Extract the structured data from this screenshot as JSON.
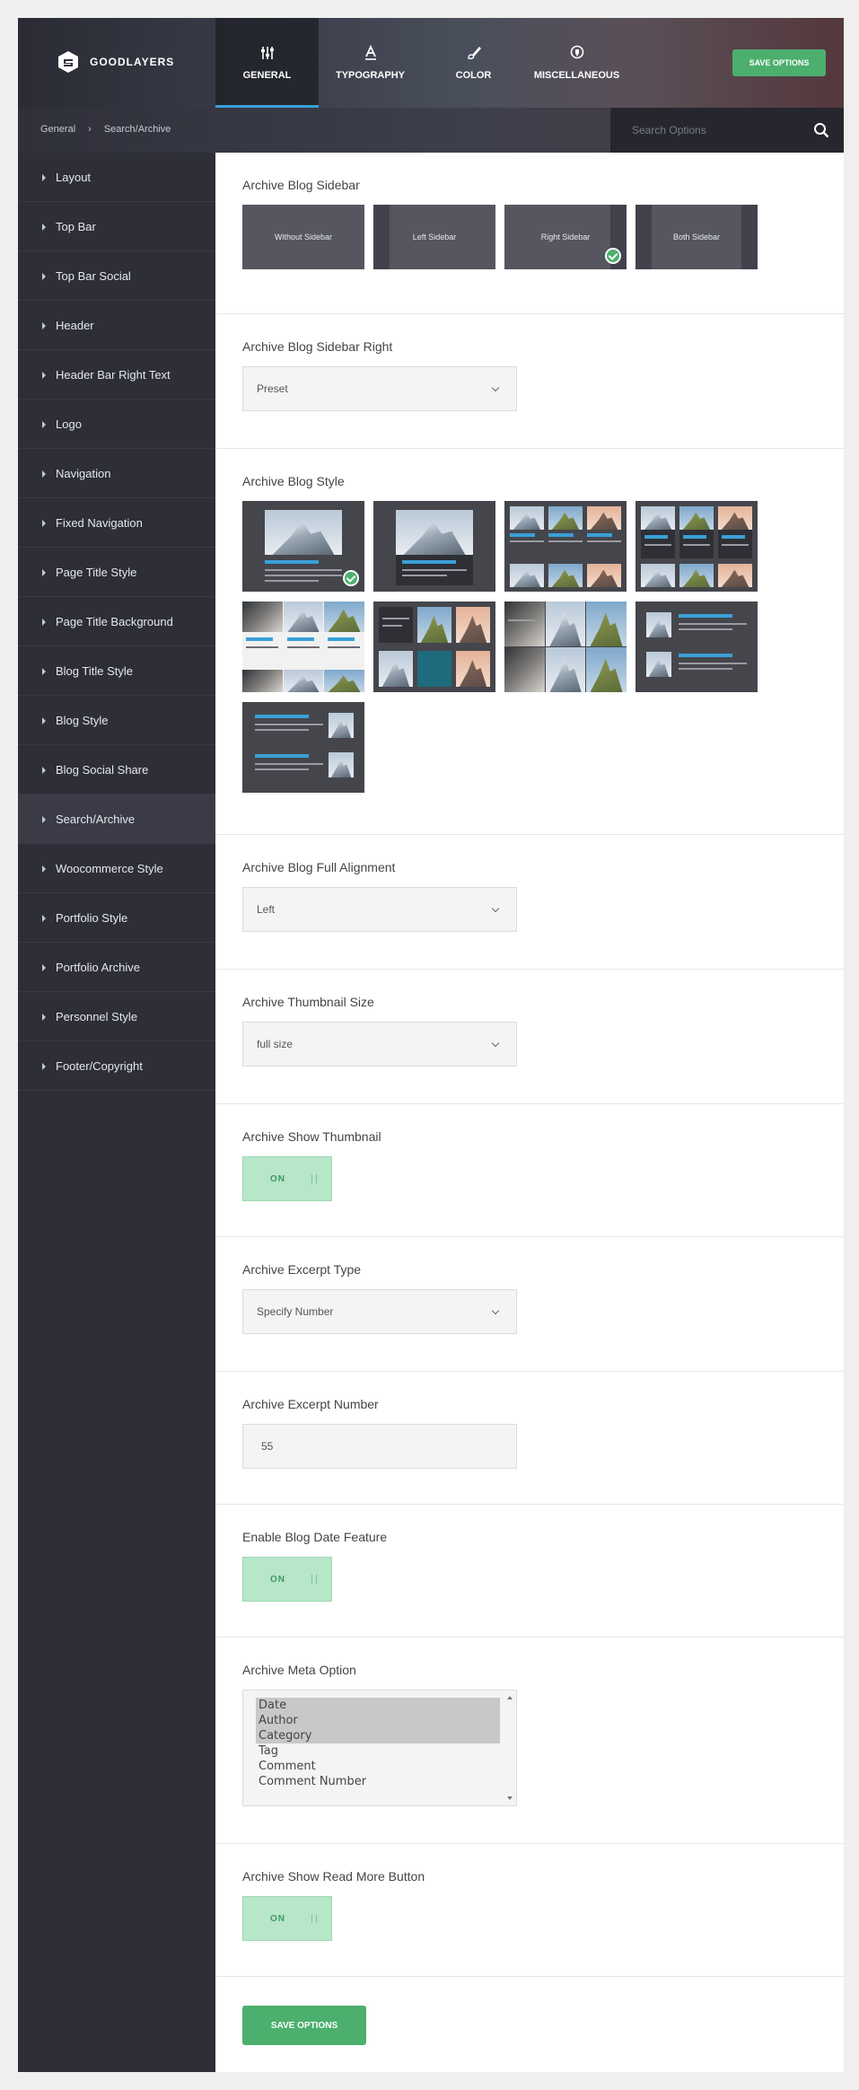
{
  "brand": {
    "name": "GOODLAYERS"
  },
  "main_tabs": [
    {
      "label": "GENERAL",
      "icon": "sliders-icon",
      "active": true
    },
    {
      "label": "TYPOGRAPHY",
      "icon": "typography-icon",
      "active": false
    },
    {
      "label": "COLOR",
      "icon": "brush-icon",
      "active": false
    },
    {
      "label": "MISCELLANEOUS",
      "icon": "shield-icon",
      "active": false
    }
  ],
  "top_save_label": "SAVE OPTIONS",
  "breadcrumb": {
    "parent": "General",
    "separator": "›",
    "current": "Search/Archive"
  },
  "search": {
    "placeholder": "Search Options"
  },
  "sidebar": {
    "items": [
      "Layout",
      "Top Bar",
      "Top Bar Social",
      "Header",
      "Header Bar Right Text",
      "Logo",
      "Navigation",
      "Fixed Navigation",
      "Page Title Style",
      "Page Title Background",
      "Blog Title Style",
      "Blog Style",
      "Blog Social Share",
      "Search/Archive",
      "Woocommerce Style",
      "Portfolio Style",
      "Portfolio Archive",
      "Personnel Style",
      "Footer/Copyright"
    ],
    "active": "Search/Archive"
  },
  "sections": {
    "sidebar_layout": {
      "title": "Archive Blog Sidebar",
      "options": [
        "Without Sidebar",
        "Left Sidebar",
        "Right Sidebar",
        "Both Sidebar"
      ],
      "selected": "Right Sidebar"
    },
    "sidebar_right": {
      "title": "Archive Blog Sidebar Right",
      "value": "Preset"
    },
    "blog_style": {
      "title": "Archive Blog Style",
      "selected_index": 0,
      "count": 9
    },
    "full_alignment": {
      "title": "Archive Blog Full Alignment",
      "value": "Left"
    },
    "thumbnail_size": {
      "title": "Archive Thumbnail Size",
      "value": "full size"
    },
    "show_thumbnail": {
      "title": "Archive Show Thumbnail",
      "value": "ON"
    },
    "excerpt_type": {
      "title": "Archive Excerpt Type",
      "value": "Specify Number"
    },
    "excerpt_number": {
      "title": "Archive Excerpt Number",
      "value": "55"
    },
    "date_feature": {
      "title": "Enable Blog Date Feature",
      "value": "ON"
    },
    "meta_option": {
      "title": "Archive Meta Option",
      "options": [
        "Date",
        "Author",
        "Category",
        "Tag",
        "Comment",
        "Comment Number"
      ],
      "selected": [
        "Date",
        "Author",
        "Category"
      ]
    },
    "read_more": {
      "title": "Archive Show Read More Button",
      "value": "ON"
    }
  },
  "bottom_save_label": "SAVE OPTIONS",
  "colors": {
    "accent_green": "#4caf6e",
    "accent_blue": "#3aa0d8",
    "sidebar_bg": "#2d2e38"
  }
}
